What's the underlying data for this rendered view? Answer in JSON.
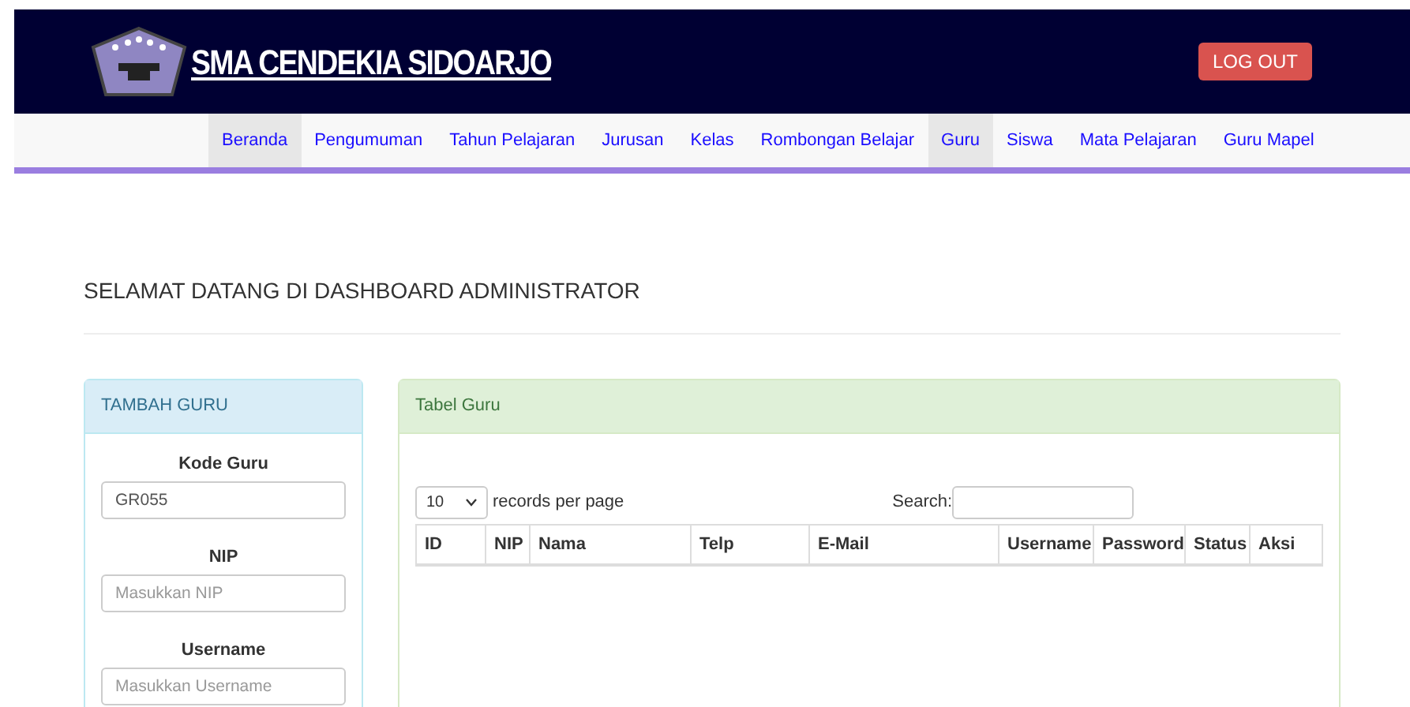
{
  "header": {
    "title": "SMA CENDEKIA SIDOARJO",
    "logout": "LOG OUT"
  },
  "nav": [
    {
      "label": "Beranda",
      "selected": true
    },
    {
      "label": "Pengumuman",
      "selected": false
    },
    {
      "label": "Tahun Pelajaran",
      "selected": false
    },
    {
      "label": "Jurusan",
      "selected": false
    },
    {
      "label": "Kelas",
      "selected": false
    },
    {
      "label": "Rombongan Belajar",
      "selected": false
    },
    {
      "label": "Guru",
      "selected": true
    },
    {
      "label": "Siswa",
      "selected": false
    },
    {
      "label": "Mata Pelajaran",
      "selected": false
    },
    {
      "label": "Guru Mapel",
      "selected": false
    }
  ],
  "heading": "SELAMAT DATANG DI DASHBOARD ADMINISTRATOR",
  "form_panel": {
    "title": "TAMBAH GURU",
    "fields": [
      {
        "label": "Kode Guru",
        "value": "GR055"
      },
      {
        "label": "NIP",
        "placeholder": "Masukkan NIP"
      },
      {
        "label": "Username",
        "placeholder": "Masukkan Username"
      }
    ]
  },
  "table_panel": {
    "title": "Tabel Guru",
    "page_size": "10",
    "page_size_label": "records per page",
    "search_label": "Search:",
    "columns": [
      "ID",
      "NIP",
      "Nama",
      "Telp",
      "E-Mail",
      "Username",
      "Password",
      "Status",
      "Aksi"
    ]
  }
}
